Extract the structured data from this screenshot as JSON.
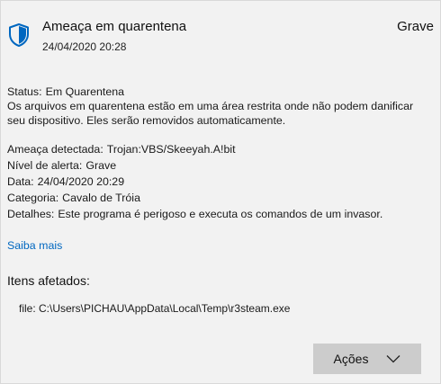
{
  "header": {
    "title": "Ameaça em quarentena",
    "timestamp": "24/04/2020 20:28",
    "severity": "Grave",
    "icon": "shield-icon"
  },
  "status": {
    "label": "Status:",
    "value": "Em Quarentena",
    "description": "Os arquivos em quarentena estão em uma área restrita onde não podem danificar seu dispositivo. Eles serão removidos automaticamente."
  },
  "details": [
    {
      "label": "Ameaça detectada:",
      "value": "Trojan:VBS/Skeeyah.A!bit"
    },
    {
      "label": "Nível de alerta:",
      "value": "Grave"
    },
    {
      "label": "Data:",
      "value": "24/04/2020 20:29"
    },
    {
      "label": "Categoria:",
      "value": "Cavalo de Tróia"
    },
    {
      "label": "Detalhes:",
      "value": "Este programa é perigoso e executa os comandos de um invasor."
    }
  ],
  "learn_more": "Saiba mais",
  "affected": {
    "title": "Itens afetados:",
    "file": "file: C:\\Users\\PICHAU\\AppData\\Local\\Temp\\r3steam.exe"
  },
  "actions": {
    "label": "Ações",
    "icon": "chevron-down-icon"
  },
  "colors": {
    "link": "#0067c0",
    "shield": "#0067c0",
    "panel_bg": "#f2f2f2",
    "button_bg": "#cccccc"
  }
}
